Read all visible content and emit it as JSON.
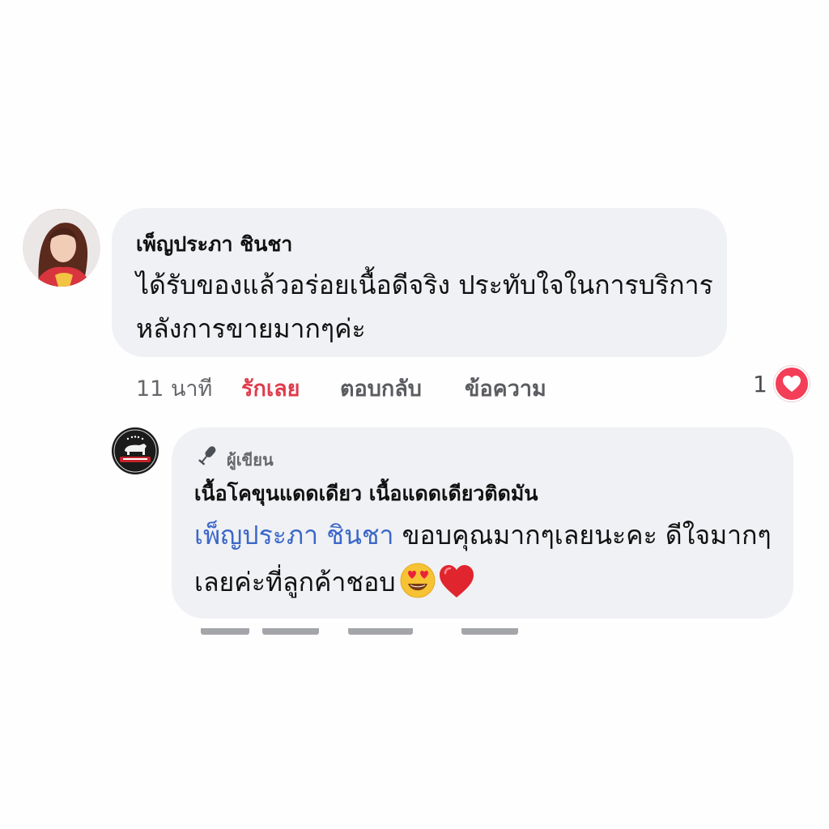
{
  "comment": {
    "author": "เพ็ญประภา ชินชา",
    "text": "ได้รับของแล้วอร่อยเนื้อดีจริง ประทับใจในการบริการหลังการขายมากๆค่ะ",
    "time": "11 นาที",
    "actions": {
      "like": "รักเลย",
      "reply": "ตอบกลับ",
      "message": "ข้อความ"
    },
    "reaction_count": "1",
    "reaction_icon": "love-reaction-icon",
    "colors": {
      "bubble": "#f0f1f4",
      "liked": "#e03c4d",
      "heart": "#f33e58"
    }
  },
  "reply": {
    "badge": "ผู้เขียน",
    "badge_icon": "microphone-icon",
    "author": "เนื้อโคขุนแดดเดียว เนื้อแดดเดียวติดมัน",
    "mention": "เพ็ญประภา ชินชา",
    "text": " ขอบคุณมากๆเลยนะคะ ดีใจมากๆเลยค่ะที่ลูกค้าชอบ",
    "emojis": [
      "heart-eyes-emoji",
      "red-heart-emoji"
    ],
    "colors": {
      "mention": "#3b67c9"
    }
  }
}
